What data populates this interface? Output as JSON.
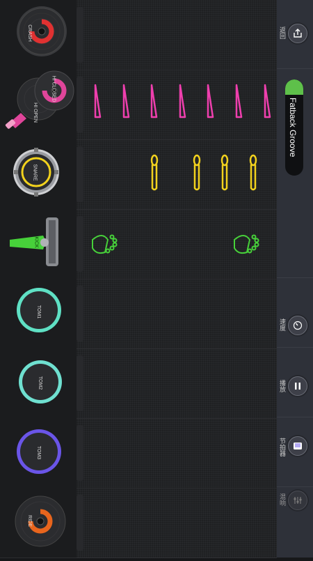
{
  "rows": [
    {
      "id": "crash",
      "label": "CRASH",
      "color": "#e03131"
    },
    {
      "id": "hihat",
      "label_open": "HI OPEN",
      "label_closed": "HI CLOSED",
      "color": "#e0459a"
    },
    {
      "id": "snare",
      "label": "SNARE",
      "color": "#f2d21d"
    },
    {
      "id": "kick",
      "label": "KICK",
      "color": "#47d13a"
    },
    {
      "id": "tom1",
      "label": "TOM1",
      "color": "#5fe0c4"
    },
    {
      "id": "tom2",
      "label": "TOM2",
      "color": "#6fe0d0"
    },
    {
      "id": "tom3",
      "label": "TOM3",
      "color": "#6a55e8"
    },
    {
      "id": "ride",
      "label": "RIDE",
      "color": "#e8651d"
    }
  ],
  "sidebar": {
    "share_label": "返回",
    "pattern_name": "Fatback Groove",
    "tempo_label": "速度",
    "play_label": "播放",
    "metronome_label": "节拍器",
    "mixer_label": "混响"
  },
  "colors": {
    "accent_green": "#5ec04a",
    "sidebar_bg": "#2e3139"
  }
}
